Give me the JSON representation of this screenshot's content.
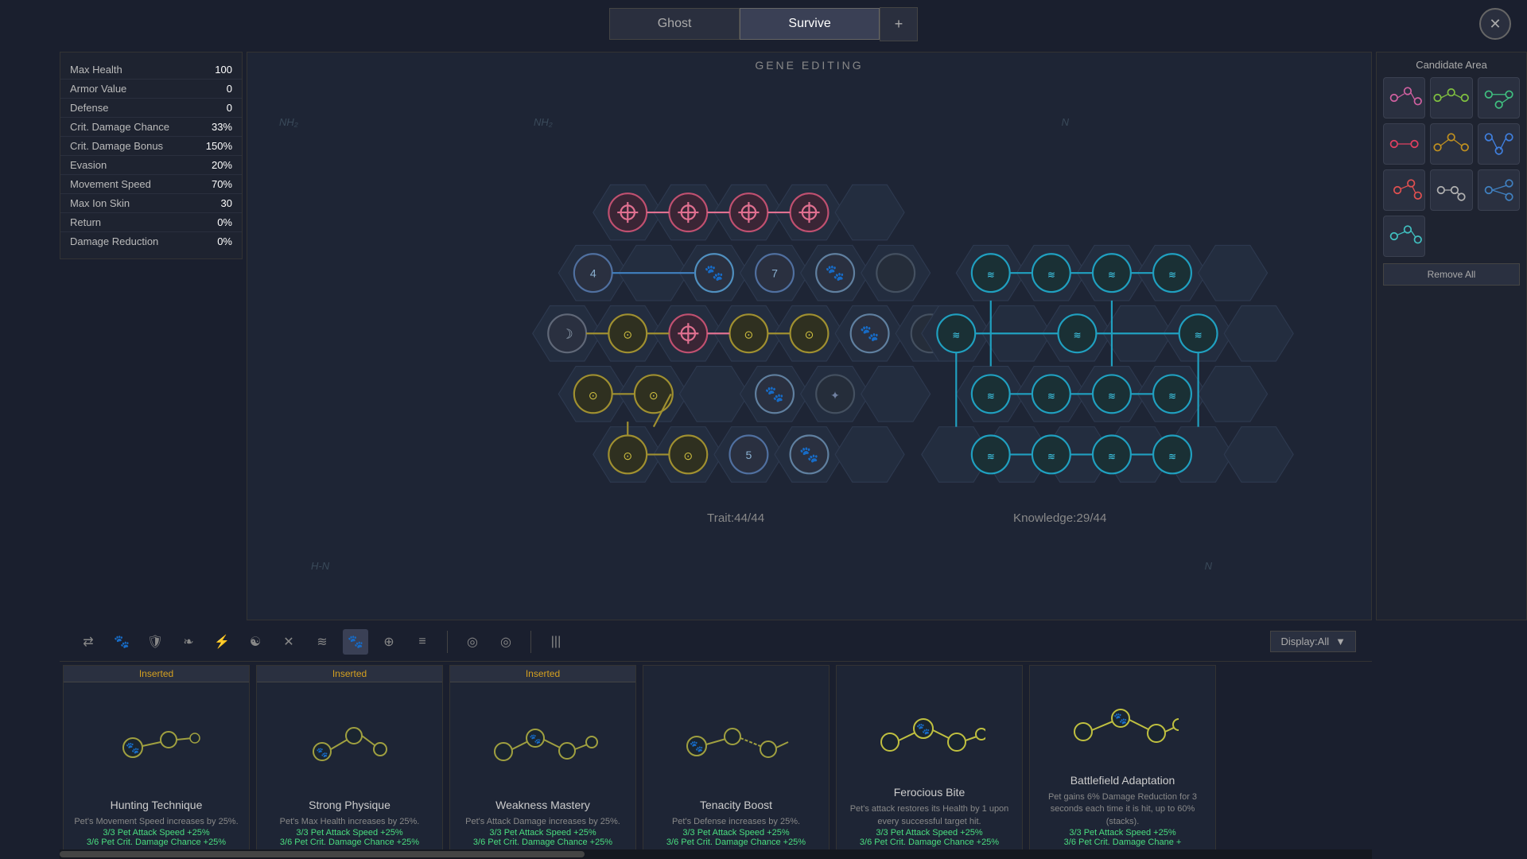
{
  "tabs": [
    {
      "label": "Ghost",
      "active": false
    },
    {
      "label": "Survive",
      "active": true
    }
  ],
  "tab_add": "+",
  "close_label": "✕",
  "stats": [
    {
      "name": "Max Health",
      "value": "100"
    },
    {
      "name": "Armor Value",
      "value": "0"
    },
    {
      "name": "Defense",
      "value": "0"
    },
    {
      "name": "Crit. Damage Chance",
      "value": "33%"
    },
    {
      "name": "Crit. Damage Bonus",
      "value": "150%"
    },
    {
      "name": "Evasion",
      "value": "20%"
    },
    {
      "name": "Movement Speed",
      "value": "70%"
    },
    {
      "name": "Max Ion Skin",
      "value": "30"
    },
    {
      "name": "Return",
      "value": "0%"
    },
    {
      "name": "Damage Reduction",
      "value": "0%"
    }
  ],
  "gene_label": "GENE EDITING",
  "trait_label": "Trait:44/44",
  "knowledge_label": "Knowledge:29/44",
  "candidate_area": {
    "title": "Candidate Area",
    "remove_all": "Remove All"
  },
  "display": {
    "label": "Display:All"
  },
  "cards": [
    {
      "badge": "Inserted",
      "title": "Hunting Technique",
      "desc": "Pet's Movement Speed increases by 25%.",
      "stats": [
        "3/3 Pet Attack Speed +25%",
        "3/6 Pet Crit. Damage Chance +25%"
      ],
      "color": "#a0a040",
      "type": "paw-small"
    },
    {
      "badge": "Inserted",
      "title": "Strong Physique",
      "desc": "Pet's Max Health increases by 25%.",
      "stats": [
        "3/3 Pet Attack Speed +25%",
        "3/6 Pet Crit. Damage Chance +25%"
      ],
      "color": "#a0a040",
      "type": "paw-branch"
    },
    {
      "badge": "Inserted",
      "title": "Weakness Mastery",
      "desc": "Pet's Attack Damage increases by 25%.",
      "stats": [
        "3/3 Pet Attack Speed +25%",
        "3/6 Pet Crit. Damage Chance +25%"
      ],
      "color": "#a0a040",
      "type": "paw-branch2"
    },
    {
      "badge": "",
      "title": "Tenacity Boost",
      "desc": "Pet's Defense increases by 25%.",
      "stats": [
        "3/3 Pet Attack Speed +25%",
        "3/6 Pet Crit. Damage Chance +25%"
      ],
      "color": "#a0a040",
      "type": "paw-curved"
    },
    {
      "badge": "",
      "title": "Ferocious Bite",
      "desc": "Pet's attack restores its Health by 1 upon every successful target hit.",
      "stats": [
        "3/3 Pet Attack Speed +25%",
        "3/6 Pet Crit. Damage Chance +25%"
      ],
      "color": "#c8c840",
      "type": "paw-center"
    },
    {
      "badge": "",
      "title": "Battlefield Adaptation",
      "desc": "Pet gains 6% Damage Reduction for 3 seconds each time it is hit, up to 60% (stacks).",
      "stats": [
        "3/3 Pet Attack Speed +25%",
        "3/6 Pet Crit. Damage Chane +"
      ],
      "color": "#c8c840",
      "type": "paw-right"
    }
  ],
  "filter_icons": [
    "⇄",
    "🐾",
    "⚔",
    "🛡",
    "⚡",
    "☯",
    "✕",
    "≋",
    "🐾",
    "⊕",
    "≡",
    "◎",
    "◎",
    "|||"
  ]
}
